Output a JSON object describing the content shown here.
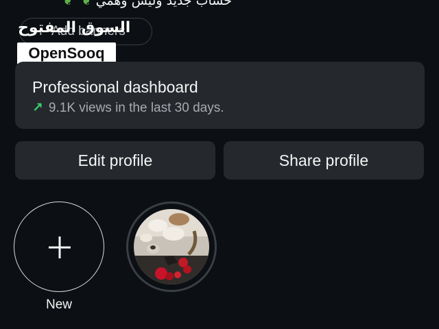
{
  "profile": {
    "bio_line": "حساب جديد وليس وهمي"
  },
  "add_banners": {
    "label": "Add banners",
    "icon": "plus-icon"
  },
  "watermark": {
    "arabic": "السوق المفتوح",
    "latin": "OpenSooq"
  },
  "dashboard": {
    "title": "Professional dashboard",
    "subtitle": "9.1K views in the last 30 days.",
    "trend_icon": "trend-up-arrow-icon",
    "trend_color": "#3bd16f"
  },
  "buttons": {
    "edit": "Edit profile",
    "share": "Share profile"
  },
  "highlights": {
    "new_label": "New",
    "items": [
      {
        "thumbnail": "food-table-photo"
      }
    ]
  }
}
